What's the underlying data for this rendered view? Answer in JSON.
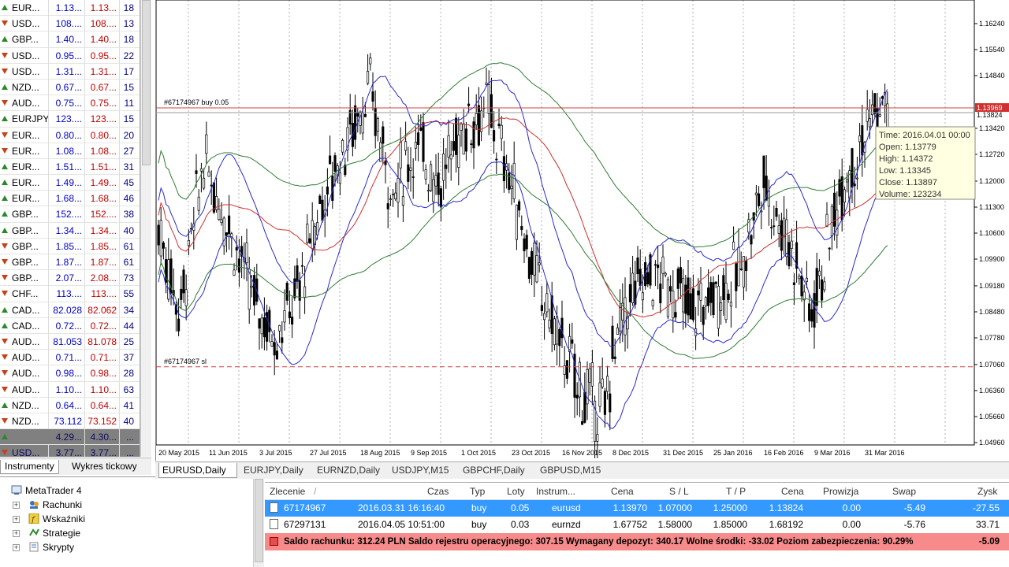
{
  "market_watch": {
    "rows": [
      {
        "symbol": "EUR...",
        "bid": "1.13...",
        "ask": "1.13...",
        "spread": "18",
        "dir": "up"
      },
      {
        "symbol": "USD...",
        "bid": "108....",
        "ask": "108....",
        "spread": "13",
        "dir": "dn"
      },
      {
        "symbol": "GBP...",
        "bid": "1.40...",
        "ask": "1.40...",
        "spread": "18",
        "dir": "up"
      },
      {
        "symbol": "USD...",
        "bid": "0.95...",
        "ask": "0.95...",
        "spread": "22",
        "dir": "dn"
      },
      {
        "symbol": "USD...",
        "bid": "1.31...",
        "ask": "1.31...",
        "spread": "17",
        "dir": "dn"
      },
      {
        "symbol": "NZD...",
        "bid": "0.67...",
        "ask": "0.67...",
        "spread": "15",
        "dir": "up"
      },
      {
        "symbol": "AUD...",
        "bid": "0.75...",
        "ask": "0.75...",
        "spread": "11",
        "dir": "dn"
      },
      {
        "symbol": "EURJPY",
        "bid": "123....",
        "ask": "123....",
        "spread": "15",
        "dir": "up"
      },
      {
        "symbol": "EUR...",
        "bid": "0.80...",
        "ask": "0.80...",
        "spread": "20",
        "dir": "dn"
      },
      {
        "symbol": "EUR...",
        "bid": "1.08...",
        "ask": "1.08...",
        "spread": "27",
        "dir": "dn"
      },
      {
        "symbol": "EUR...",
        "bid": "1.51...",
        "ask": "1.51...",
        "spread": "31",
        "dir": "up"
      },
      {
        "symbol": "EUR...",
        "bid": "1.49...",
        "ask": "1.49...",
        "spread": "45",
        "dir": "up"
      },
      {
        "symbol": "EUR...",
        "bid": "1.68...",
        "ask": "1.68...",
        "spread": "46",
        "dir": "up"
      },
      {
        "symbol": "GBP...",
        "bid": "152....",
        "ask": "152....",
        "spread": "38",
        "dir": "up"
      },
      {
        "symbol": "GBP...",
        "bid": "1.34...",
        "ask": "1.34...",
        "spread": "40",
        "dir": "up"
      },
      {
        "symbol": "GBP...",
        "bid": "1.85...",
        "ask": "1.85...",
        "spread": "61",
        "dir": "dn"
      },
      {
        "symbol": "GBP...",
        "bid": "1.87...",
        "ask": "1.87...",
        "spread": "61",
        "dir": "dn"
      },
      {
        "symbol": "GBP...",
        "bid": "2.07...",
        "ask": "2.08...",
        "spread": "73",
        "dir": "dn"
      },
      {
        "symbol": "CHF...",
        "bid": "113....",
        "ask": "113....",
        "spread": "55",
        "dir": "dn"
      },
      {
        "symbol": "CAD...",
        "bid": "82.028",
        "ask": "82.062",
        "spread": "34",
        "dir": "up"
      },
      {
        "symbol": "CAD...",
        "bid": "0.72...",
        "ask": "0.72...",
        "spread": "44",
        "dir": "up"
      },
      {
        "symbol": "AUD...",
        "bid": "81.053",
        "ask": "81.078",
        "spread": "25",
        "dir": "dn"
      },
      {
        "symbol": "AUD...",
        "bid": "0.71...",
        "ask": "0.71...",
        "spread": "37",
        "dir": "dn"
      },
      {
        "symbol": "AUD...",
        "bid": "0.98...",
        "ask": "0.98...",
        "spread": "28",
        "dir": "dn"
      },
      {
        "symbol": "AUD...",
        "bid": "1.10...",
        "ask": "1.10...",
        "spread": "63",
        "dir": "dn"
      },
      {
        "symbol": "NZD...",
        "bid": "0.64...",
        "ask": "0.64...",
        "spread": "41",
        "dir": "up"
      },
      {
        "symbol": "NZD...",
        "bid": "73.112",
        "ask": "73.152",
        "spread": "40",
        "dir": "dn"
      },
      {
        "symbol": "",
        "bid": "4.29...",
        "ask": "4.30...",
        "spread": "...",
        "dir": "up",
        "highlight": true
      },
      {
        "symbol": "USD...",
        "bid": "3.77...",
        "ask": "3.77...",
        "spread": "...",
        "dir": "dn",
        "highlight": true
      }
    ],
    "tabs": [
      "Instrumenty",
      "Wykres tickowy"
    ]
  },
  "navigator": {
    "root": "MetaTrader 4",
    "items": [
      "Rachunki",
      "Wskaźniki",
      "Strategie",
      "Skrypty"
    ]
  },
  "chart": {
    "order_label": "#67174967 buy 0.05",
    "sl_label": "#67174967 sl",
    "price_ticks": [
      "1.16240",
      "1.15540",
      "1.14840",
      "1.13420",
      "1.12720",
      "1.12000",
      "1.11300",
      "1.10600",
      "1.09900",
      "1.09180",
      "1.08480",
      "1.07780",
      "1.07060",
      "1.06360",
      "1.05660",
      "1.04960"
    ],
    "current_price_1": "1.13969",
    "current_price_2": "1.13824",
    "date_ticks": [
      "20 May 2015",
      "11 Jun 2015",
      "3 Jul 2015",
      "27 Jul 2015",
      "18 Aug 2015",
      "9 Sep 2015",
      "1 Oct 2015",
      "23 Oct 2015",
      "16 Nov 2015",
      "8 Dec 2015",
      "31 Dec 2015",
      "25 Jan 2016",
      "16 Feb 2016",
      "9 Mar 2016",
      "31 Mar 2016"
    ],
    "tooltip": {
      "time": "Time: 2016.04.01 00:00",
      "open": "Open: 1.13779",
      "high": "High: 1.14372",
      "low": "Low: 1.13345",
      "close": "Close: 1.13897",
      "volume": "Volume: 123234"
    },
    "colors": {
      "candle": "#000000",
      "ma_red": "#d03030",
      "ma_green": "#2f7d32",
      "band_blue": "#2a2ad0",
      "order_line": "#d04040"
    },
    "tabs": [
      "EURUSD,Daily",
      "EURJPY,Daily",
      "EURNZD,Daily",
      "USDJPY,M15",
      "GBPCHF,Daily",
      "GBPUSD,M15"
    ]
  },
  "terminal": {
    "headers": [
      "Zlecenie",
      "/",
      "Czas",
      "Typ",
      "Loty",
      "Instrum...",
      "Cena",
      "S / L",
      "T / P",
      "Cena",
      "Prowizja",
      "Swap",
      "Zysk"
    ],
    "orders": [
      {
        "ticket": "67174967",
        "time": "2016.03.31 16:16:40",
        "type": "buy",
        "lots": "0.05",
        "symbol": "eurusd",
        "price": "1.13970",
        "sl": "1.07000",
        "tp": "1.25000",
        "cur": "1.13824",
        "comm": "0.00",
        "swap": "-5.49",
        "profit": "-27.55",
        "selected": true
      },
      {
        "ticket": "67297131",
        "time": "2016.04.05 10:51:00",
        "type": "buy",
        "lots": "0.03",
        "symbol": "eurnzd",
        "price": "1.67752",
        "sl": "1.58000",
        "tp": "1.85000",
        "cur": "1.68192",
        "comm": "0.00",
        "swap": "-5.76",
        "profit": "33.71",
        "selected": false
      }
    ],
    "balance_text": "Saldo rachunku: 312.24 PLN  Saldo rejestru operacyjnego: 307.15  Wymagany depozyt: 340.17  Wolne środki: -33.02  Poziom zabezpieczenia: 90.29%",
    "balance_profit": "-5.09"
  }
}
